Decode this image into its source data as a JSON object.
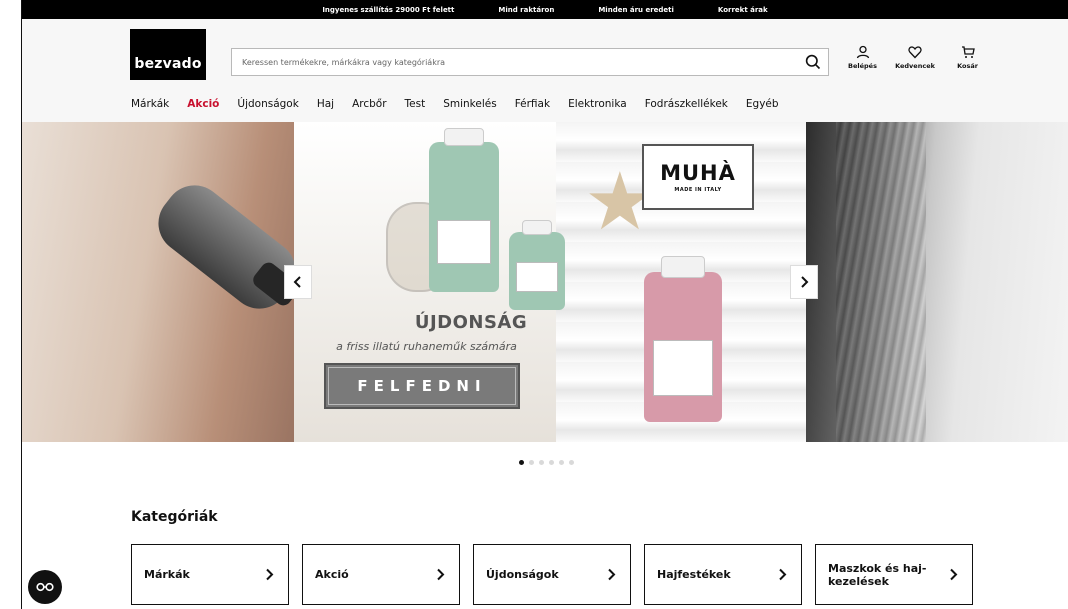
{
  "topbar": {
    "items": [
      "Ingyenes szállítás 29000 Ft felett",
      "Mind raktáron",
      "Minden áru eredeti",
      "Korrekt árak"
    ]
  },
  "header": {
    "logo": "bezvado",
    "search": {
      "placeholder": "Keressen termékekre, márkákra vagy kategóriákra",
      "icon": "search-icon"
    },
    "actions": [
      {
        "label": "Belépés",
        "icon": "user-icon"
      },
      {
        "label": "Kedvencek",
        "icon": "heart-icon"
      },
      {
        "label": "Kosár",
        "icon": "cart-icon"
      }
    ]
  },
  "nav": {
    "items": [
      "Márkák",
      "Akció",
      "Újdonságok",
      "Haj",
      "Arcbőr",
      "Test",
      "Sminkelés",
      "Férfiak",
      "Elektronika",
      "Fodrászkellékek",
      "Egyéb"
    ],
    "highlight_color": "#c8102e"
  },
  "hero": {
    "brand": "MUHÀ",
    "brand_sub": "MADE IN ITALY",
    "title": "ÚJDONSÁG",
    "subtitle": "a friss illatú ruhaneműk számára",
    "cta": "FELFEDNI",
    "slide_count": 6,
    "active_slide": 1
  },
  "categories": {
    "title": "Kategóriák",
    "items": [
      "Márkák",
      "Akció",
      "Újdonságok",
      "Hajfestékek",
      "Maszkok és haj-kezelések"
    ]
  },
  "fab": {
    "icon": "glasses-icon"
  }
}
